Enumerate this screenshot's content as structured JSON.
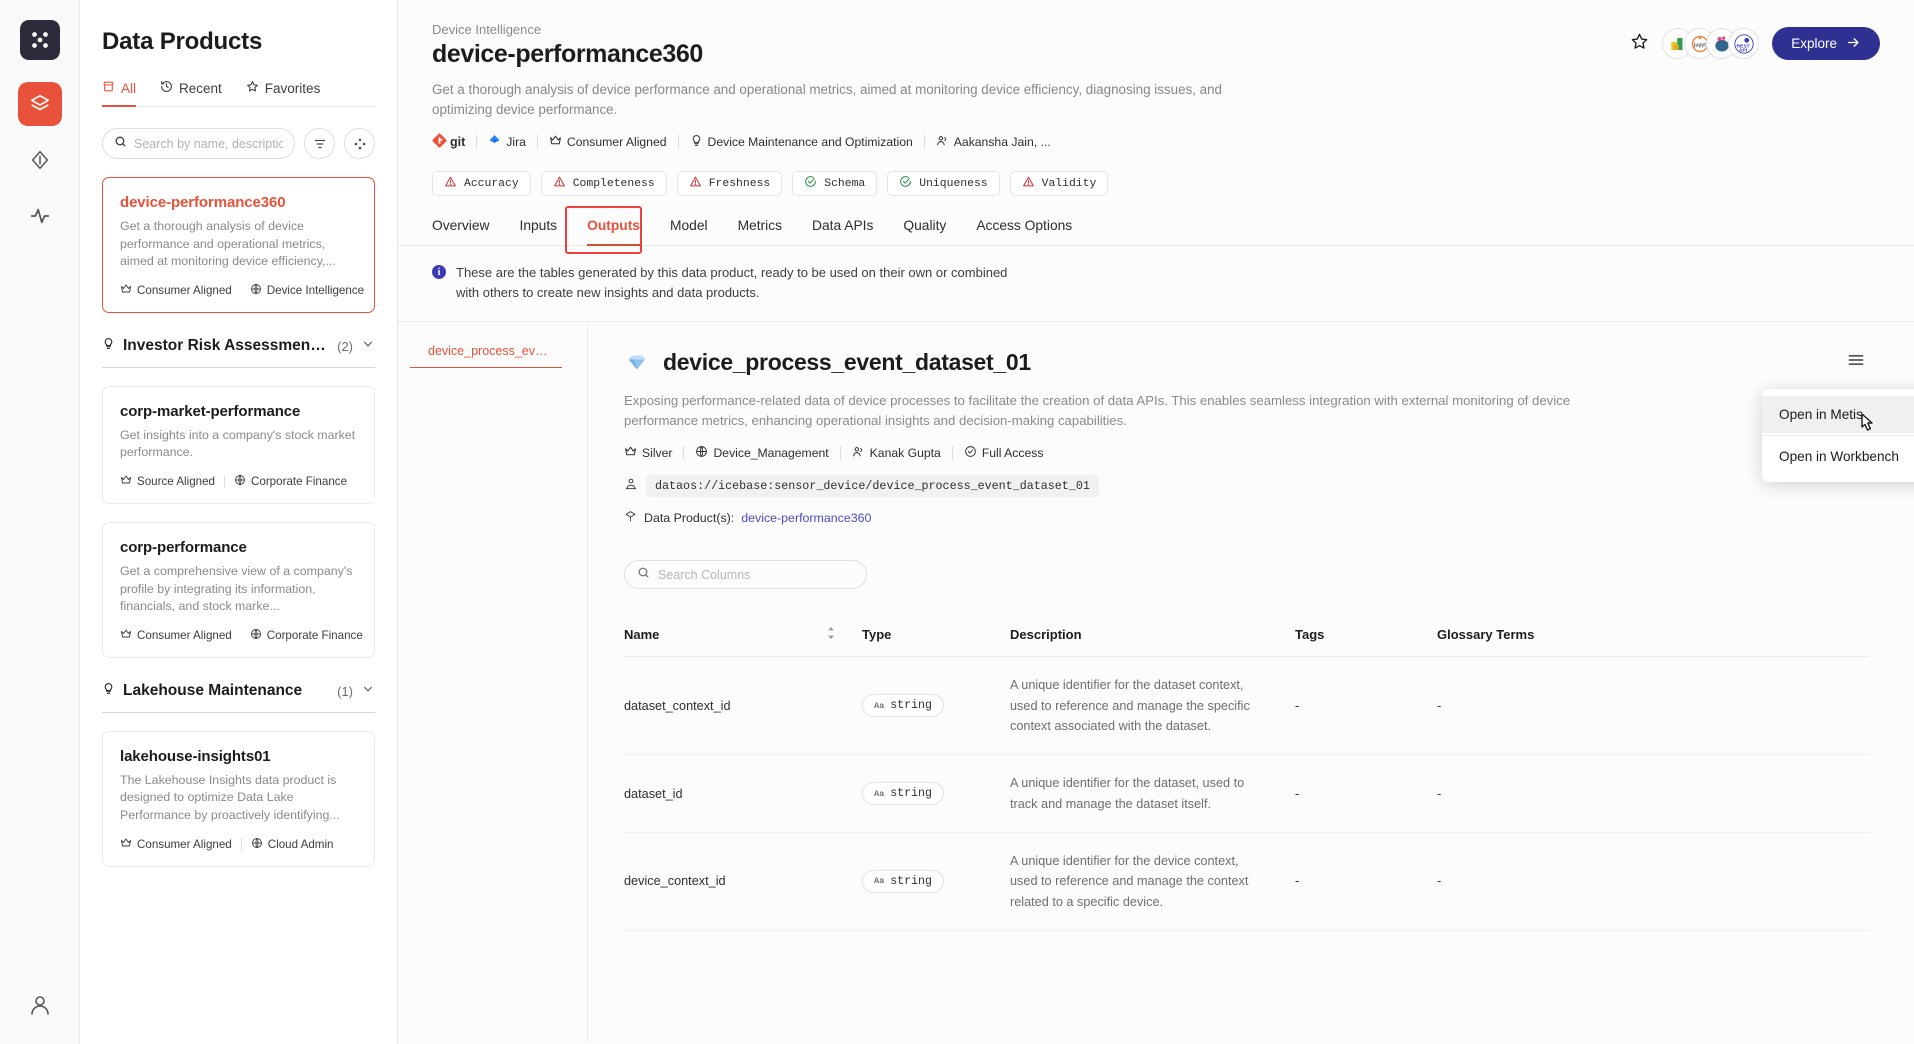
{
  "rail": {
    "logo_icon": "grid-logo-icon",
    "items": [
      {
        "name": "layers-icon",
        "active": true
      },
      {
        "name": "beaker-icon",
        "active": false
      },
      {
        "name": "activity-icon",
        "active": false
      }
    ],
    "bottom_item": {
      "name": "user-account-icon"
    }
  },
  "left_panel": {
    "title": "Data Products",
    "tabs": [
      {
        "label": "All",
        "icon": "database-icon",
        "active": true
      },
      {
        "label": "Recent",
        "icon": "history-icon",
        "active": false
      },
      {
        "label": "Favorites",
        "icon": "star-icon",
        "active": false
      }
    ],
    "search": {
      "placeholder": "Search by name, description,...",
      "value": ""
    },
    "filter_icon": "filter-icon",
    "settings_icon": "nodes-icon",
    "cards": [
      {
        "name": "device-performance360",
        "description": "Get a thorough analysis of device performance and operational metrics, aimed at monitoring device efficiency,...",
        "tier": "Consumer Aligned",
        "domain": "Device Intelligence",
        "selected": true
      }
    ],
    "groups": [
      {
        "title": "Investor Risk Assessment ...",
        "count": "(2)",
        "cards": [
          {
            "name": "corp-market-performance",
            "description": "Get insights into a company's stock market performance.",
            "tier": "Source Aligned",
            "domain": "Corporate Finance",
            "selected": false
          },
          {
            "name": "corp-performance",
            "description": "Get a comprehensive view of a company's profile by integrating its information, financials, and stock marke...",
            "tier": "Consumer Aligned",
            "domain": "Corporate Finance",
            "selected": false
          }
        ]
      },
      {
        "title": "Lakehouse Maintenance",
        "count": "(1)",
        "cards": [
          {
            "name": "lakehouse-insights01",
            "description": "The Lakehouse Insights data product is designed to optimize Data Lake Performance by proactively identifying...",
            "tier": "Consumer Aligned",
            "domain": "Cloud Admin",
            "selected": false
          }
        ]
      }
    ]
  },
  "header": {
    "breadcrumb": "Device Intelligence",
    "title": "device-performance360",
    "description": "Get a thorough analysis of device performance and operational metrics, aimed at monitoring device efficiency, diagnosing issues, and optimizing device performance.",
    "star_icon": "star-outline-icon",
    "explore_label": "Explore",
    "explore_color": "#2f3192",
    "avatars": [
      {
        "name": "avatar-superset",
        "label": "sup"
      },
      {
        "name": "avatar-jupyter",
        "label": "jupyt"
      },
      {
        "name": "avatar-postgres",
        "label": "pg"
      },
      {
        "name": "avatar-restapi",
        "label": "REST API"
      }
    ],
    "meta": [
      {
        "icon": "git-icon",
        "label": "git"
      },
      {
        "icon": "jira-icon",
        "label": "Jira"
      },
      {
        "icon": "crown-icon",
        "label": "Consumer Aligned"
      },
      {
        "icon": "bulb-icon",
        "label": "Device Maintenance and Optimization"
      },
      {
        "icon": "users-icon",
        "label": "Aakansha Jain, ..."
      }
    ],
    "quality": [
      {
        "label": "Accuracy",
        "status": "warning"
      },
      {
        "label": "Completeness",
        "status": "warning"
      },
      {
        "label": "Freshness",
        "status": "warning"
      },
      {
        "label": "Schema",
        "status": "ok"
      },
      {
        "label": "Uniqueness",
        "status": "ok"
      },
      {
        "label": "Validity",
        "status": "warning"
      }
    ],
    "warning_color": "#d0343a",
    "ok_color": "#2f8f4e",
    "accent_color": "#e8523a"
  },
  "tabs": [
    {
      "label": "Overview",
      "active": false
    },
    {
      "label": "Inputs",
      "active": false
    },
    {
      "label": "Outputs",
      "active": true
    },
    {
      "label": "Model",
      "active": false
    },
    {
      "label": "Metrics",
      "active": false
    },
    {
      "label": "Data APIs",
      "active": false
    },
    {
      "label": "Quality",
      "active": false
    },
    {
      "label": "Access Options",
      "active": false
    }
  ],
  "info_banner": {
    "icon": "info-icon",
    "text": "These are the tables generated by this data product, ready to be used on their own or combined with others to create new insights and data products."
  },
  "dataset_list": [
    {
      "label": "device_process_event...",
      "active": true
    }
  ],
  "dataset": {
    "icon": "dataset-diamond-icon",
    "title": "device_process_event_dataset_01",
    "description": "Exposing performance-related data of device processes to facilitate the creation of data APIs. This enables seamless integration with external monitoring of device performance metrics, enhancing operational insights and decision-making capabilities.",
    "menu_icon": "hamburger-menu-icon",
    "meta": [
      {
        "icon": "crown-icon",
        "label": "Silver"
      },
      {
        "icon": "globe-icon",
        "label": "Device_Management"
      },
      {
        "icon": "users-icon",
        "label": "Kanak Gupta"
      },
      {
        "icon": "shield-check-icon",
        "label": "Full Access"
      }
    ],
    "uri_icon": "address-icon",
    "uri": "dataos://icebase:sensor_device/device_process_event_dataset_01",
    "data_products_icon": "cube-icon",
    "data_products_label": "Data Product(s):",
    "data_products_link": "device-performance360"
  },
  "columns_search": {
    "placeholder": "Search Columns",
    "value": "",
    "icon": "search-icon"
  },
  "columns_table": {
    "headers": [
      "Name",
      "Type",
      "Description",
      "Tags",
      "Glossary Terms"
    ],
    "rows": [
      {
        "name": "dataset_context_id",
        "type": "string",
        "description": "A unique identifier for the dataset context, used to reference and manage the specific context associated with the dataset.",
        "tags": "-",
        "glossary": "-"
      },
      {
        "name": "dataset_id",
        "type": "string",
        "description": "A unique identifier for the dataset, used to track and manage the dataset itself.",
        "tags": "-",
        "glossary": "-"
      },
      {
        "name": "device_context_id",
        "type": "string",
        "description": "A unique identifier for the device context, used to reference and manage the context related to a specific device.",
        "tags": "-",
        "glossary": "-"
      }
    ]
  },
  "context_menu": {
    "items": [
      {
        "label": "Open in Metis",
        "hovered": true
      },
      {
        "label": "Open in Workbench",
        "hovered": false
      }
    ]
  }
}
